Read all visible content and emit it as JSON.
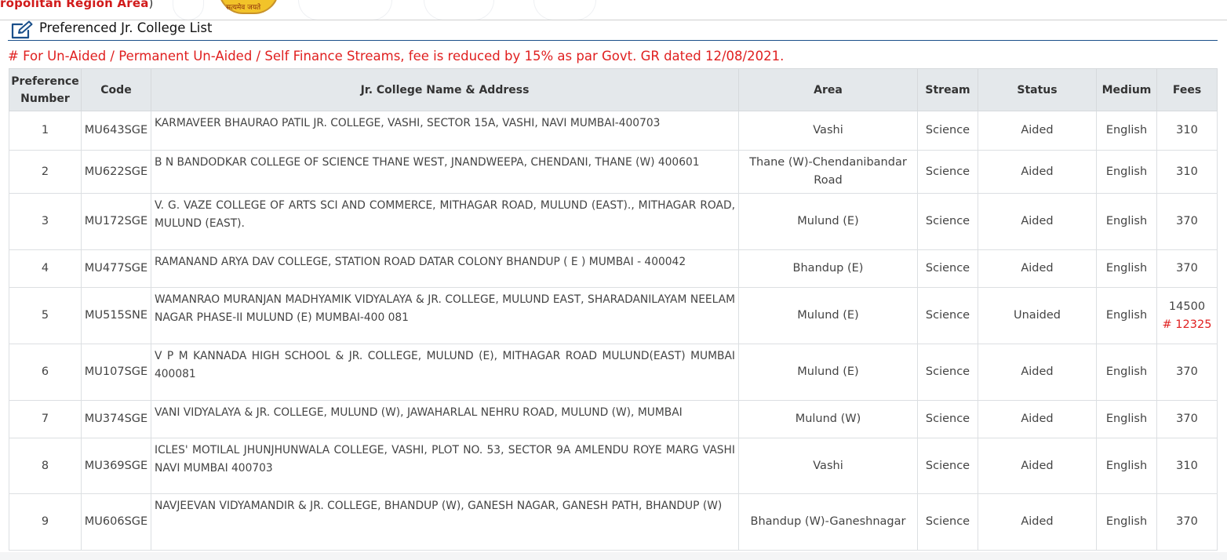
{
  "header": {
    "region_text": "ropolitan Region Area",
    "region_paren": ")",
    "emblem_text": "सत्यमेव जयते"
  },
  "section": {
    "title": "Preferenced Jr. College List",
    "icon": "edit-icon"
  },
  "notice": "# For Un-Aided / Permanent Un-Aided / Self Finance Streams, fee is reduced by 15% as par Govt. GR dated 12/08/2021.",
  "colors": {
    "notice_red": "#e02020",
    "header_bg": "#e4e8eb",
    "rule_blue": "#1a4f8a"
  },
  "table": {
    "columns": [
      "Preference Number",
      "Code",
      "Jr. College Name & Address",
      "Area",
      "Stream",
      "Status",
      "Medium",
      "Fees"
    ],
    "rows": [
      {
        "pref": "1",
        "code": "MU643SGE",
        "name": "KARMAVEER BHAURAO PATIL JR. COLLEGE, VASHI, SECTOR 15A, VASHI, NAVI MUMBAI-400703",
        "area": "Vashi",
        "stream": "Science",
        "status": "Aided",
        "medium": "English",
        "fees": "310",
        "fee_note": ""
      },
      {
        "pref": "2",
        "code": "MU622SGE",
        "name": "B N BANDODKAR COLLEGE OF SCIENCE THANE WEST, JNANDWEEPA, CHENDANI, THANE (W) 400601",
        "area": "Thane (W)-Chendanibandar Road",
        "stream": "Science",
        "status": "Aided",
        "medium": "English",
        "fees": "310",
        "fee_note": ""
      },
      {
        "pref": "3",
        "code": "MU172SGE",
        "name": "V. G. VAZE COLLEGE OF ARTS SCI AND COMMERCE, MITHAGAR ROAD, MULUND (EAST)., MITHAGAR ROAD, MULUND (EAST).",
        "area": "Mulund (E)",
        "stream": "Science",
        "status": "Aided",
        "medium": "English",
        "fees": "370",
        "fee_note": ""
      },
      {
        "pref": "4",
        "code": "MU477SGE",
        "name": "RAMANAND ARYA DAV COLLEGE, STATION ROAD DATAR COLONY BHANDUP ( E ) MUMBAI - 400042",
        "area": "Bhandup (E)",
        "stream": "Science",
        "status": "Aided",
        "medium": "English",
        "fees": "370",
        "fee_note": ""
      },
      {
        "pref": "5",
        "code": "MU515SNE",
        "name": "WAMANRAO MURANJAN MADHYAMIK VIDYALAYA & JR. COLLEGE, MULUND EAST, SHARADANILAYAM NEELAM NAGAR PHASE-II MULUND (E) MUMBAI-400 081",
        "area": "Mulund (E)",
        "stream": "Science",
        "status": "Unaided",
        "medium": "English",
        "fees": "14500",
        "fee_note": "# 12325"
      },
      {
        "pref": "6",
        "code": "MU107SGE",
        "name": "V P M KANNADA HIGH SCHOOL & JR. COLLEGE, MULUND (E), MITHAGAR ROAD MULUND(EAST) MUMBAI 400081",
        "area": "Mulund (E)",
        "stream": "Science",
        "status": "Aided",
        "medium": "English",
        "fees": "370",
        "fee_note": ""
      },
      {
        "pref": "7",
        "code": "MU374SGE",
        "name": "VANI VIDYALAYA & JR. COLLEGE, MULUND (W), JAWAHARLAL NEHRU ROAD, MULUND (W), MUMBAI",
        "area": "Mulund (W)",
        "stream": "Science",
        "status": "Aided",
        "medium": "English",
        "fees": "370",
        "fee_note": ""
      },
      {
        "pref": "8",
        "code": "MU369SGE",
        "name": "ICLES' MOTILAL JHUNJHUNWALA COLLEGE, VASHI, PLOT NO. 53, SECTOR 9A AMLENDU ROYE MARG VASHI NAVI MUMBAI 400703",
        "area": "Vashi",
        "stream": "Science",
        "status": "Aided",
        "medium": "English",
        "fees": "310",
        "fee_note": ""
      },
      {
        "pref": "9",
        "code": "MU606SGE",
        "name": "NAVJEEVAN VIDYAMANDIR & JR. COLLEGE, BHANDUP (W), GANESH NAGAR, GANESH PATH, BHANDUP (W)",
        "area": "Bhandup (W)-Ganeshnagar",
        "stream": "Science",
        "status": "Aided",
        "medium": "English",
        "fees": "370",
        "fee_note": ""
      }
    ]
  }
}
